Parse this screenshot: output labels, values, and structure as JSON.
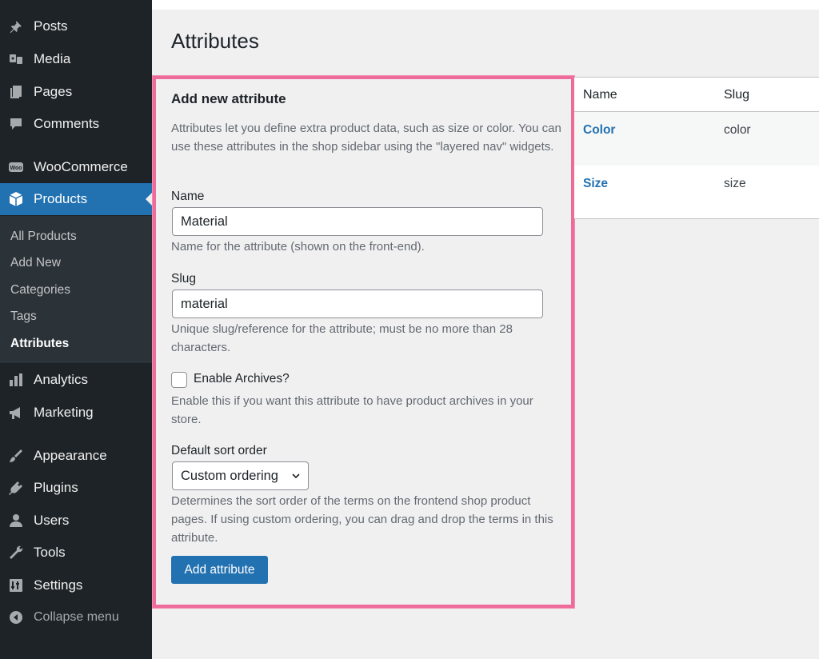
{
  "sidebar": {
    "menu": {
      "posts": "Posts",
      "media": "Media",
      "pages": "Pages",
      "comments": "Comments",
      "woocommerce": "WooCommerce",
      "products": "Products",
      "analytics": "Analytics",
      "marketing": "Marketing",
      "appearance": "Appearance",
      "plugins": "Plugins",
      "users": "Users",
      "tools": "Tools",
      "settings": "Settings",
      "collapse": "Collapse menu"
    },
    "submenu": {
      "all_products": "All Products",
      "add_new": "Add New",
      "categories": "Categories",
      "tags": "Tags",
      "attributes": "Attributes"
    },
    "woo_icon_text": "Woo"
  },
  "page": {
    "title": "Attributes"
  },
  "form": {
    "title": "Add new attribute",
    "intro": "Attributes let you define extra product data, such as size or color. You can use these attributes in the shop sidebar using the \"layered nav\" widgets.",
    "name_label": "Name",
    "name_value": "Material",
    "name_help": "Name for the attribute (shown on the front-end).",
    "slug_label": "Slug",
    "slug_value": "material",
    "slug_help": "Unique slug/reference for the attribute; must be no more than 28 characters.",
    "archives_label": "Enable Archives?",
    "archives_checked": false,
    "archives_help": "Enable this if you want this attribute to have product archives in your store.",
    "sort_label": "Default sort order",
    "sort_value": "Custom ordering",
    "sort_help": "Determines the sort order of the terms on the frontend shop product pages. If using custom ordering, you can drag and drop the terms in this attribute.",
    "submit_label": "Add attribute"
  },
  "table": {
    "headers": {
      "name": "Name",
      "slug": "Slug"
    },
    "rows": [
      {
        "name": "Color",
        "slug": "color"
      },
      {
        "name": "Size",
        "slug": "size"
      }
    ]
  },
  "colors": {
    "sidebar_bg": "#1d2327",
    "active_blue": "#2271b1",
    "highlight_border": "#ee6c9a"
  }
}
